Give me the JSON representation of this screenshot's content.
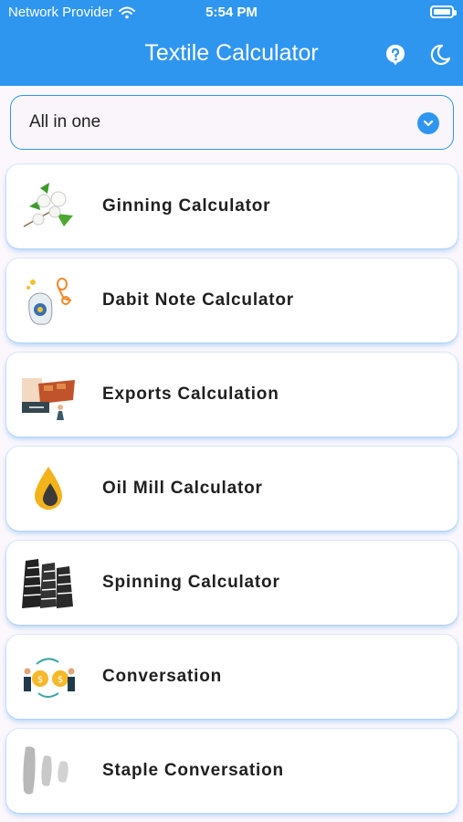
{
  "status_bar": {
    "carrier": "Network Provider",
    "time": "5:54 PM"
  },
  "app_bar": {
    "title": "Textile Calculator",
    "help_icon": "help-icon",
    "theme_icon": "dark-mode-icon"
  },
  "colors": {
    "primary": "#2f96f0",
    "background": "#fbf7fc"
  },
  "dropdown": {
    "selected": "All in one"
  },
  "calculators": [
    {
      "label": "Ginning Calculator",
      "icon": "cotton-icon"
    },
    {
      "label": "Dabit Note Calculator",
      "icon": "money-bag-icon"
    },
    {
      "label": "Exports Calculation",
      "icon": "export-ship-icon"
    },
    {
      "label": "Oil Mill Calculator",
      "icon": "oil-drop-icon"
    },
    {
      "label": "Spinning Calculator",
      "icon": "yarn-cone-icon"
    },
    {
      "label": "Conversation",
      "icon": "currency-exchange-icon"
    },
    {
      "label": "Staple Conversation",
      "icon": "fiber-staple-icon"
    }
  ]
}
